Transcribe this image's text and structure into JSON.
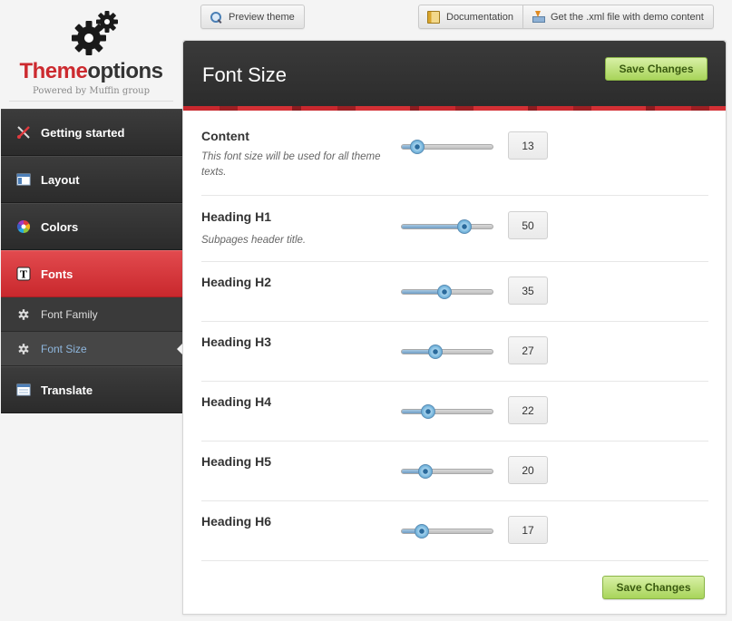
{
  "toolbar": {
    "preview_label": "Preview theme",
    "documentation_label": "Documentation",
    "xml_label": "Get the .xml file with demo content"
  },
  "logo": {
    "title_red": "Theme",
    "title_dark": "options",
    "subtitle": "Powered by Muffin group"
  },
  "sidebar": {
    "items": [
      {
        "label": "Getting started",
        "icon": "tools-icon"
      },
      {
        "label": "Layout",
        "icon": "layout-icon"
      },
      {
        "label": "Colors",
        "icon": "color-wheel-icon"
      },
      {
        "label": "Fonts",
        "icon": "text-t-icon",
        "active": true
      }
    ],
    "subitems": [
      {
        "label": "Font Family",
        "icon": "gear-icon"
      },
      {
        "label": "Font Size",
        "icon": "gear-icon",
        "active": true
      }
    ],
    "bottom": {
      "label": "Translate",
      "icon": "window-icon"
    }
  },
  "panel": {
    "title": "Font Size",
    "save_label": "Save Changes",
    "save_label_bottom": "Save Changes"
  },
  "slider_range": [
    0,
    100
  ],
  "settings": [
    {
      "label": "Content",
      "desc": "This font size will be used for all theme texts.",
      "value": "13",
      "fraction": 0.17
    },
    {
      "label": "Heading H1",
      "desc": "Subpages header title.",
      "value": "50",
      "fraction": 0.69
    },
    {
      "label": "Heading H2",
      "desc": "",
      "value": "35",
      "fraction": 0.47
    },
    {
      "label": "Heading H3",
      "desc": "",
      "value": "27",
      "fraction": 0.37
    },
    {
      "label": "Heading H4",
      "desc": "",
      "value": "22",
      "fraction": 0.29
    },
    {
      "label": "Heading H5",
      "desc": "",
      "value": "20",
      "fraction": 0.26
    },
    {
      "label": "Heading H6",
      "desc": "",
      "value": "17",
      "fraction": 0.22
    }
  ],
  "colors": {
    "accent_red": "#cc2a2f",
    "save_green": "#a8d45a",
    "sidebar_dark": "#2b2b2b",
    "active_sub_text": "#8fb7de"
  }
}
